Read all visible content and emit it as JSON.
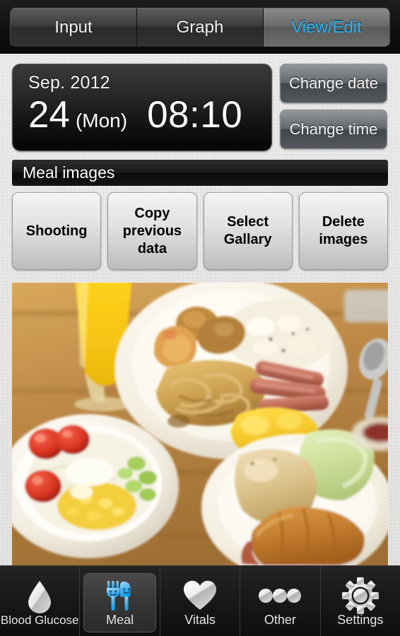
{
  "tabs": [
    {
      "label": "Input",
      "active": false
    },
    {
      "label": "Graph",
      "active": false
    },
    {
      "label": "View/Edit",
      "active": true
    }
  ],
  "datetime": {
    "month_year": "Sep. 2012",
    "day": "24",
    "day_of_week": "(Mon)",
    "time": "08:10"
  },
  "controls": {
    "change_date": "Change date",
    "change_time": "Change time"
  },
  "section": {
    "title": "Meal images"
  },
  "actions": [
    {
      "label": "Shooting",
      "name": "shooting-button"
    },
    {
      "label": "Copy previous data",
      "name": "copy-previous-data-button"
    },
    {
      "label": "Select Gallary",
      "name": "select-gallary-button"
    },
    {
      "label": "Delete images",
      "name": "delete-images-button"
    }
  ],
  "photo": {
    "alt": "buffet breakfast plate with noodles, sausages, scrambled egg, salad bowl, bread rolls, croissant and orange juice"
  },
  "nav": [
    {
      "label": "Blood Glucose",
      "icon": "droplet-icon",
      "active": false
    },
    {
      "label": "Meal",
      "icon": "fork-knife-icon",
      "active": true
    },
    {
      "label": "Vitals",
      "icon": "heart-icon",
      "active": false
    },
    {
      "label": "Other",
      "icon": "ellipsis-icon",
      "active": false
    },
    {
      "label": "Settings",
      "icon": "gear-icon",
      "active": false
    }
  ],
  "colors": {
    "accent": "#23b7f5",
    "panel_dark": "#1a1a1a",
    "background": "#dedcda"
  }
}
